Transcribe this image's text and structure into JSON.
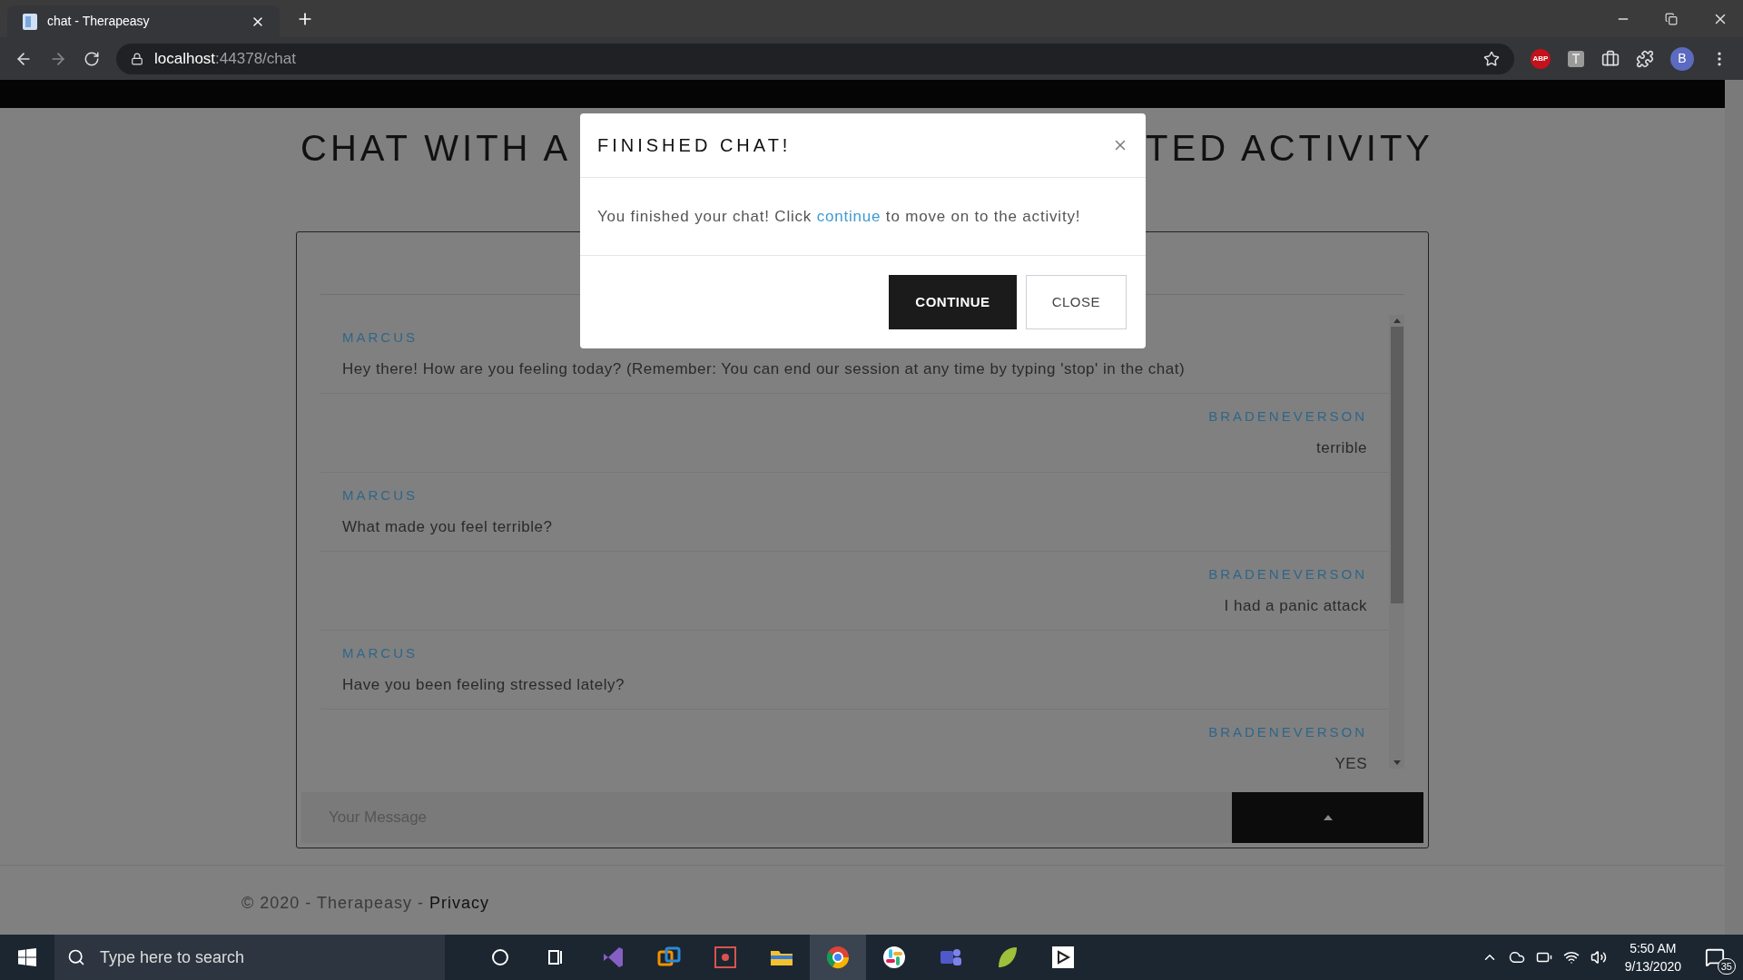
{
  "browser": {
    "tab_title": "chat - Therapeasy",
    "url_host": "localhost",
    "url_rest": ":44378/chat",
    "extension_label": "ABP",
    "profile_initial": "B"
  },
  "page": {
    "heading_left": "CHAT WITH A",
    "heading_right": "TED ACTIVITY"
  },
  "chat": {
    "messages": [
      {
        "sender": "MARCUS",
        "text": "Hey there! How are you feeling today? (Remember: You can end our session at any time by typing 'stop' in the chat)",
        "kind": "received"
      },
      {
        "sender": "BRADENEVERSON",
        "text": "terrible",
        "kind": "sent"
      },
      {
        "sender": "MARCUS",
        "text": "What made you feel terrible?",
        "kind": "received"
      },
      {
        "sender": "BRADENEVERSON",
        "text": "I had a panic attack",
        "kind": "sent"
      },
      {
        "sender": "MARCUS",
        "text": "Have you been feeling stressed lately?",
        "kind": "received"
      },
      {
        "sender": "BRADENEVERSON",
        "text": "YES",
        "kind": "sent"
      }
    ],
    "input": {
      "placeholder": "Your Message"
    }
  },
  "modal": {
    "title": "FINISHED CHAT!",
    "body_before": "You finished your chat! Click ",
    "link": "continue",
    "body_after": " to move on to the activity!",
    "buttons": [
      {
        "label": "CONTINUE",
        "kind": "primary"
      },
      {
        "label": "CLOSE",
        "kind": "secondary"
      }
    ]
  },
  "footer": {
    "copyright": "© 2020 - Therapeasy - ",
    "link": "Privacy"
  },
  "taskbar": {
    "search_placeholder": "Type here to search",
    "time": "5:50 AM",
    "date": "9/13/2020",
    "notification_count": "35"
  }
}
